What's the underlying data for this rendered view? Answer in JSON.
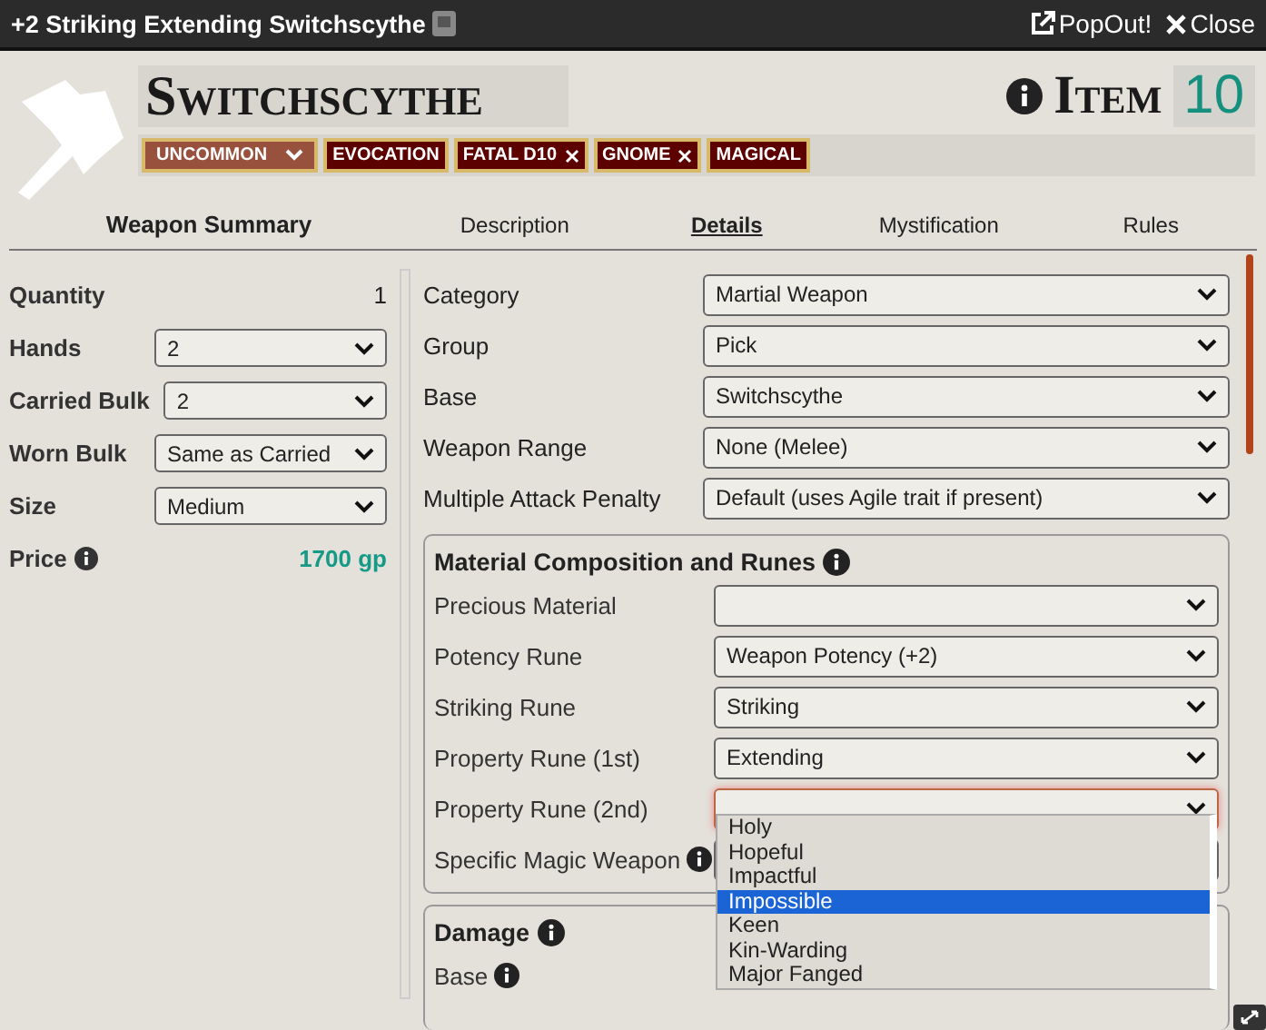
{
  "window": {
    "title": "+2 Striking Extending Switchscythe",
    "actions": [
      "PopOut!",
      "Close"
    ]
  },
  "header": {
    "name": "Switchscythe",
    "type": "Item",
    "level": "10"
  },
  "traits": [
    {
      "label": "UNCOMMON",
      "kind": "rarity"
    },
    {
      "label": "EVOCATION",
      "kind": "trait",
      "removable": false
    },
    {
      "label": "FATAL D10",
      "kind": "trait",
      "removable": true
    },
    {
      "label": "GNOME",
      "kind": "trait",
      "removable": true
    },
    {
      "label": "MAGICAL",
      "kind": "trait",
      "removable": false
    }
  ],
  "tabs": [
    {
      "label": "Weapon Summary",
      "kind": "heading",
      "selected": false
    },
    {
      "label": "Description",
      "kind": "tab",
      "selected": false
    },
    {
      "label": "Details",
      "kind": "tab",
      "selected": true
    },
    {
      "label": "Mystification",
      "kind": "tab",
      "selected": false
    },
    {
      "label": "Rules",
      "kind": "tab",
      "selected": false
    }
  ],
  "summary": [
    {
      "label": "Quantity",
      "kind": "text",
      "value": "1"
    },
    {
      "label": "Hands",
      "kind": "select",
      "value": "2"
    },
    {
      "label": "Carried Bulk",
      "kind": "select",
      "value": "2"
    },
    {
      "label": "Worn Bulk",
      "kind": "select",
      "value": "Same as Carried"
    },
    {
      "label": "Size",
      "kind": "select",
      "value": "Medium"
    },
    {
      "label": "Price",
      "kind": "price",
      "value": "1700 gp"
    }
  ],
  "details": [
    {
      "label": "Category",
      "value": "Martial Weapon"
    },
    {
      "label": "Group",
      "value": "Pick"
    },
    {
      "label": "Base",
      "value": "Switchscythe"
    },
    {
      "label": "Weapon Range",
      "value": "None (Melee)"
    },
    {
      "label": "Multiple Attack Penalty",
      "value": "Default (uses Agile trait if present)"
    }
  ],
  "runes": {
    "title": "Material Composition and Runes",
    "fields": [
      {
        "label": "Precious Material",
        "focused": false,
        "info": false
      },
      {
        "label": "Potency Rune",
        "value": "Weapon Potency (+2)",
        "focused": false,
        "info": false
      },
      {
        "label": "Striking Rune",
        "value": "Striking",
        "focused": false,
        "info": false
      },
      {
        "label": "Property Rune (1st)",
        "value": "Extending",
        "focused": false,
        "info": false
      },
      {
        "label": "Property Rune (2nd)",
        "focused": true,
        "info": false
      },
      {
        "label": "Specific Magic Weapon",
        "focused": false,
        "info": true
      }
    ]
  },
  "damage": {
    "title": "Damage",
    "fields": [
      {
        "label": "Base",
        "info": true
      }
    ]
  },
  "dropdown": [
    {
      "label": "Holy",
      "selected": false
    },
    {
      "label": "Hopeful",
      "selected": false
    },
    {
      "label": "Impactful",
      "selected": false
    },
    {
      "label": "Impossible",
      "selected": true
    },
    {
      "label": "Keen",
      "selected": false
    },
    {
      "label": "Kin-Warding",
      "selected": false
    },
    {
      "label": "Major Fanged",
      "selected": false
    }
  ]
}
